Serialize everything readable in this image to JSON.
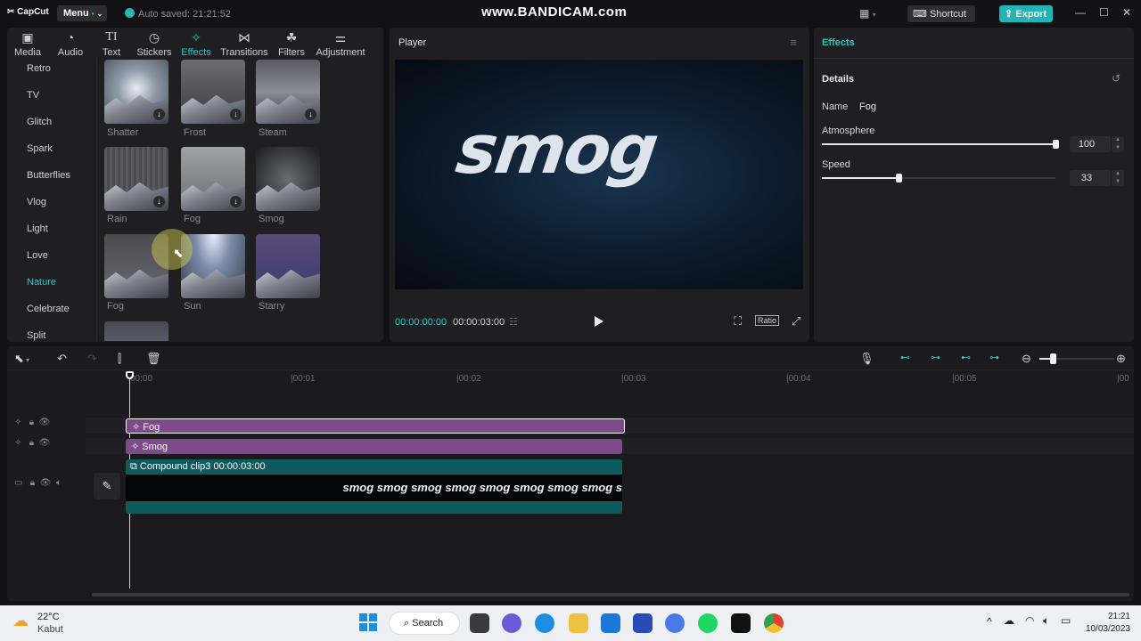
{
  "app": {
    "logo": "CapCut",
    "menu_label": "Menu",
    "autosave": "Auto saved: 21:21:52",
    "watermark": "www.BANDICAM.com",
    "shortcut_label": "Shortcut",
    "export_label": "Export"
  },
  "tabs": [
    {
      "label": "Media",
      "icon": "media-icon"
    },
    {
      "label": "Audio",
      "icon": "audio-icon"
    },
    {
      "label": "Text",
      "icon": "text-icon"
    },
    {
      "label": "Stickers",
      "icon": "stickers-icon"
    },
    {
      "label": "Effects",
      "icon": "effects-icon",
      "active": true
    },
    {
      "label": "Transitions",
      "icon": "transitions-icon"
    },
    {
      "label": "Filters",
      "icon": "filters-icon"
    },
    {
      "label": "Adjustment",
      "icon": "adjustment-icon"
    }
  ],
  "categories": [
    "Retro",
    "TV",
    "Glitch",
    "Spark",
    "Butterflies",
    "Vlog",
    "Light",
    "Love",
    "Nature",
    "Celebrate",
    "Split"
  ],
  "active_category": "Nature",
  "effects": [
    {
      "label": "Shatter",
      "download": true
    },
    {
      "label": "Frost",
      "download": true
    },
    {
      "label": "Steam",
      "download": true
    },
    {
      "label": "Rain",
      "download": true
    },
    {
      "label": "Fog",
      "download": true
    },
    {
      "label": "Smog",
      "download": false
    },
    {
      "label": "Fog",
      "download": false
    },
    {
      "label": "Sun",
      "download": false
    },
    {
      "label": "Starry",
      "download": false
    }
  ],
  "player": {
    "title": "Player",
    "video_text": "smog",
    "time_current": "00:00:00:00",
    "time_total": "00:00:03:00",
    "ratio_label": "Ratio"
  },
  "details": {
    "tab_label": "Effects",
    "title": "Details",
    "name_label": "Name",
    "name_value": "Fog",
    "atmosphere_label": "Atmosphere",
    "atmosphere_value": "100",
    "atmosphere_level": 1.0,
    "speed_label": "Speed",
    "speed_value": "33",
    "speed_level": 0.33
  },
  "timeline": {
    "ruler": [
      "00:00",
      "|00:01",
      "|00:02",
      "|00:03",
      "|00:04",
      "|00:05",
      "|00"
    ],
    "fog_track": "Fog",
    "smog_track": "Smog",
    "compound_label": "Compound clip3",
    "compound_duration": "00:00:03:00",
    "clip_text": "smog smog smog smog smog smog smog smog s"
  },
  "taskbar": {
    "weather_temp": "22°C",
    "weather_desc": "Kabut",
    "search_label": "Search",
    "clock_time": "21:21",
    "clock_date": "10/03/2023"
  },
  "colors": {
    "accent": "#27c4c4",
    "effect_track": "#7d4a8a",
    "compound_track": "#0e5a5c"
  }
}
